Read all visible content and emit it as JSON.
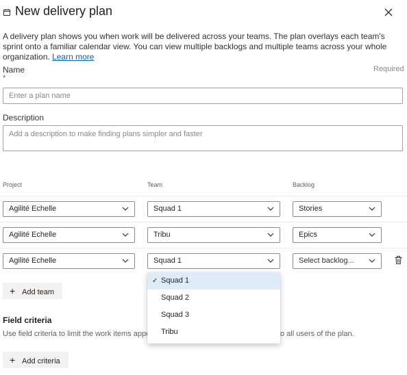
{
  "panel": {
    "title": "New delivery plan",
    "intro": "A delivery plan shows you when work will be delivered across your teams. The plan overlays each team's sprint onto a familiar calendar view. You can view multiple backlogs and multiple teams across your whole organization.",
    "learn_more": "Learn more"
  },
  "name_field": {
    "label": "Name",
    "required_marker": "*",
    "required_text": "Required",
    "placeholder": "Enter a plan name"
  },
  "description_field": {
    "label": "Description",
    "placeholder": "Add a description to make finding plans simpler and faster"
  },
  "teams_table": {
    "headers": [
      "Project",
      "Team",
      "Backlog"
    ],
    "rows": [
      {
        "project": "Agilité Echelle",
        "team": "Squad 1",
        "backlog": "Stories"
      },
      {
        "project": "Agilité Echelle",
        "team": "Tribu",
        "backlog": "Epics"
      },
      {
        "project": "Agilité Echelle",
        "team": "Squad 1",
        "backlog": "Select backlog..."
      }
    ],
    "add_team": "Add team"
  },
  "team_dropdown": {
    "options": [
      "Squad 1",
      "Squad 2",
      "Squad 3",
      "Tribu"
    ],
    "selected": "Squad 1"
  },
  "field_criteria": {
    "title": "Field criteria",
    "description_start": "Use field criteria to limit the work items appe",
    "description_end": "o all users of the plan.",
    "add_criteria": "Add criteria"
  }
}
